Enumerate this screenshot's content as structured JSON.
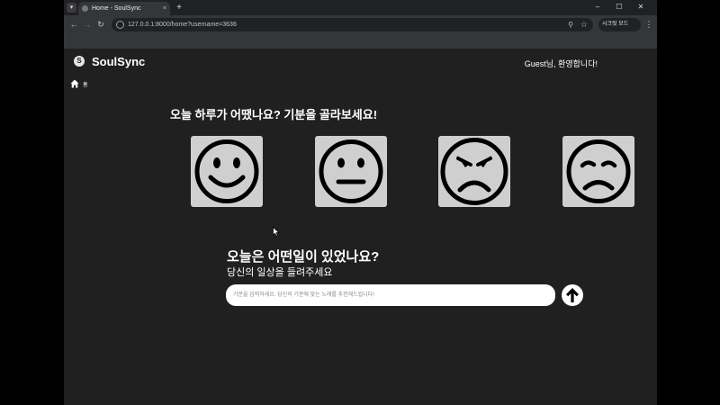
{
  "browser": {
    "tab": {
      "title": "Home - SoulSync",
      "close": "×"
    },
    "new_tab": "+",
    "window_controls": {
      "minimize": "–",
      "maximize": "☐",
      "close": "✕"
    },
    "url": "127.0.0.1:8000/home?username=3636",
    "profile_label": "시크릿 모드"
  },
  "header": {
    "brand": "SoulSync",
    "welcome": "Guest님, 환영합니다!"
  },
  "nav": {
    "home_label": "홈"
  },
  "mood": {
    "question": "오늘 하루가 어땠나요? 기분을 골라보세요!",
    "options": [
      {
        "name": "happy",
        "icon": "happy-face-icon"
      },
      {
        "name": "neutral",
        "icon": "neutral-face-icon"
      },
      {
        "name": "angry",
        "icon": "angry-face-icon"
      },
      {
        "name": "sad",
        "icon": "sad-face-icon"
      }
    ]
  },
  "story": {
    "title": "오늘은 어떤일이 있었나요?",
    "subtitle": "당신의 일상을 들려주세요",
    "placeholder": "기분을 입력하세요. 당신의 기분에 맞는 노래를 추천해드립니다!",
    "value": ""
  },
  "colors": {
    "page_bg": "#202020",
    "card_bg": "#cfcfcf",
    "face_stroke": "#000000",
    "text": "#ffffff"
  }
}
